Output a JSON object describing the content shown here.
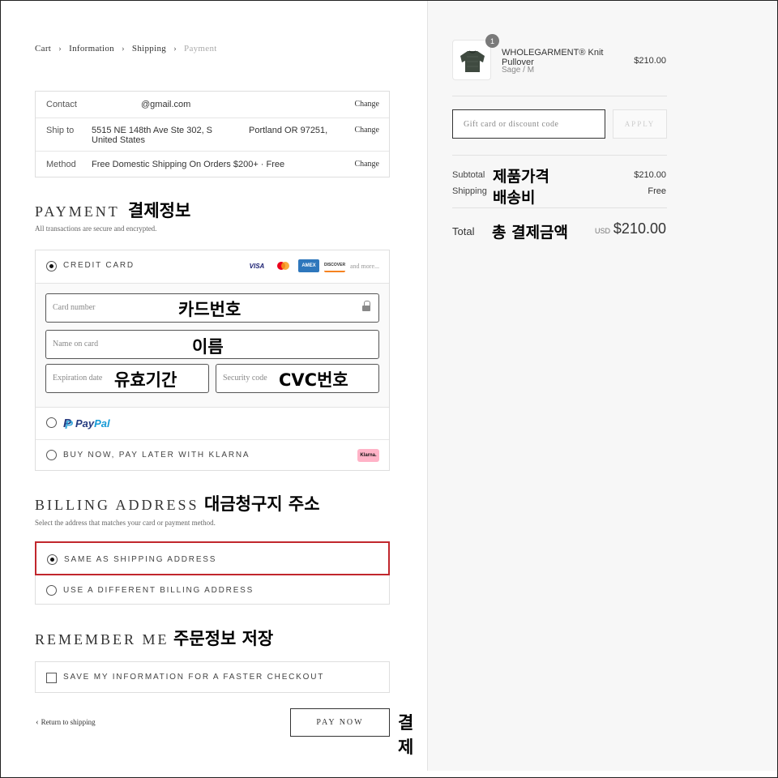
{
  "breadcrumb": {
    "items": [
      "Cart",
      "Information",
      "Shipping"
    ],
    "current": "Payment"
  },
  "review": {
    "contact": {
      "label": "Contact",
      "value": "@gmail.com",
      "change": "Change"
    },
    "ship_to": {
      "label": "Ship to",
      "line1": "5515 NE 148th Ave Ste 302, S",
      "line2": "United States",
      "city": "Portland OR 97251,",
      "change": "Change"
    },
    "method": {
      "label": "Method",
      "value": "Free Domestic Shipping On Orders $200+ · Free",
      "change": "Change"
    }
  },
  "payment": {
    "title": "PAYMENT",
    "title_ko": "결제정보",
    "subtitle": "All transactions are secure and encrypted.",
    "credit_card_label": "CREDIT CARD",
    "card_brands": [
      "VISA",
      "AMEX",
      "DISCOVER"
    ],
    "more_label": "and more...",
    "card_number_placeholder": "Card number",
    "card_number_ko": "카드번호",
    "name_placeholder": "Name on card",
    "name_ko": "이름",
    "expiry_placeholder": "Expiration date",
    "expiry_ko": "유효기간",
    "security_placeholder": "Security code",
    "security_ko": "CVC번호",
    "paypal_a": "Pay",
    "paypal_b": "Pal",
    "klarna_label": "BUY NOW, PAY LATER WITH KLARNA",
    "klarna_badge": "Klarna."
  },
  "billing": {
    "title": "BILLING ADDRESS",
    "title_ko": "대금청구지 주소",
    "subtitle": "Select the address that matches your card or payment method.",
    "same_label": "SAME AS SHIPPING ADDRESS",
    "different_label": "USE A DIFFERENT BILLING ADDRESS"
  },
  "remember": {
    "title": "REMEMBER ME",
    "title_ko": "주문정보 저장",
    "checkbox_label": "SAVE MY INFORMATION FOR A FASTER CHECKOUT"
  },
  "footer": {
    "return_label": "Return to shipping",
    "pay_now_label": "PAY NOW",
    "pay_now_ko": "결제"
  },
  "summary": {
    "product_name": "WHOLEGARMENT® Knit Pullover",
    "product_variant": "Sage / M",
    "product_price": "$210.00",
    "quantity": "1",
    "gift_placeholder": "Gift card or discount code",
    "apply_label": "APPLY",
    "subtotal_label": "Subtotal",
    "subtotal_ko": "제품가격",
    "subtotal_value": "$210.00",
    "shipping_label": "Shipping",
    "shipping_ko": "배송비",
    "shipping_value": "Free",
    "total_label": "Total",
    "total_ko": "총 결제금액",
    "currency": "USD",
    "total_value": "$210.00"
  },
  "colors": {
    "selected_border": "#c1272d",
    "sidebar_bg": "#f7f7f7",
    "text": "#333333"
  }
}
